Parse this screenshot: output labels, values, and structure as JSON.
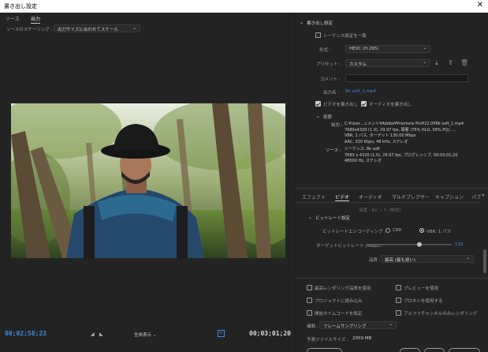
{
  "window": {
    "title": "書き出し設定",
    "close_icon": "close-icon"
  },
  "left": {
    "tabs": [
      {
        "label": "ソース"
      },
      {
        "label": "出力"
      }
    ],
    "scaling": {
      "label": "ソースのスケーリング :",
      "value": "出力サイズに合わせてスケール"
    },
    "timecode_current": "00;02;58;23",
    "timecode_end": "00;03;01;20",
    "zoom": "全体表示",
    "playhead_progress": 0.988
  },
  "export": {
    "section_title": "書き出し設定",
    "match_sequence_label": "シーケンス設定を一致",
    "format_label": "形式 :",
    "format_value": "HEVC (H.265)",
    "preset_label": "プリセット :",
    "preset_value": "カスタム",
    "comment_label": "コメント :",
    "comment_value": "",
    "output_label": "出力名 :",
    "output_value": "8k soft_1.mp4",
    "export_video_label": "ビデオを書き出し",
    "export_audio_label": "オーディオを書き出し",
    "summary_title": "概要",
    "summary_output_label": "出力 :",
    "summary_output_lines": [
      "C:¥User...ュメント¥Adobe¥Premiere Pro¥22.0¥8k soft_1.mp4",
      "7680x4320 (1.0), 29.97 fps, 顕著 (75% HLG, 58% PQ), ...",
      "VBR, 1 パス, ターゲット 130.00 Mbps",
      "AAC, 320 Kbps, 48 kHz, ステレオ"
    ],
    "summary_source_label": "ソース :",
    "summary_source_lines": [
      "シーケンス, 8k soft",
      "7680 x 4320 (1.0), 29.97 fps, プログレッシブ, 00;03;01;20",
      "48000 Hz, ステレオ"
    ]
  },
  "tabs2": [
    {
      "label": "エフェクト"
    },
    {
      "label": "ビデオ"
    },
    {
      "label": "オーディオ"
    },
    {
      "label": "マルチプレクサー"
    },
    {
      "label": "キャプション"
    },
    {
      "label": "パブ"
    }
  ],
  "video": {
    "aspect_partial": "深度 : 8ビット (無効)",
    "bitrate_section": "ビットレート設定",
    "encoding_label": "ビットレートエンコーディング :",
    "cbr_label": "CBR",
    "vbr_label": "VBR, 1 パス",
    "target_label": "ターゲットビットレート (Mbps) :",
    "target_value": "130",
    "target_fraction": 0.62,
    "quality_label": "品質 :",
    "quality_value": "最高 (最も遅い)"
  },
  "bottom": {
    "max_render_label": "最高レンダリング品質を使用",
    "use_preview_label": "プレビューを使用",
    "import_project_label": "プロジェクトに読み込み",
    "use_proxy_label": "プロキシを使用する",
    "set_start_tc_label": "開始タイムコードを設定",
    "alpha_label": "アルファチャンネルのみレンダリング",
    "interp_label": "補間 :",
    "interp_value": "フレームサンプリング",
    "filesize_label": "予測ファイルサイズ :",
    "filesize_value": "2959 MB"
  },
  "colors": {
    "accent": "#3c8ce6",
    "panel": "#232323",
    "titlebar": "#ffffff"
  }
}
